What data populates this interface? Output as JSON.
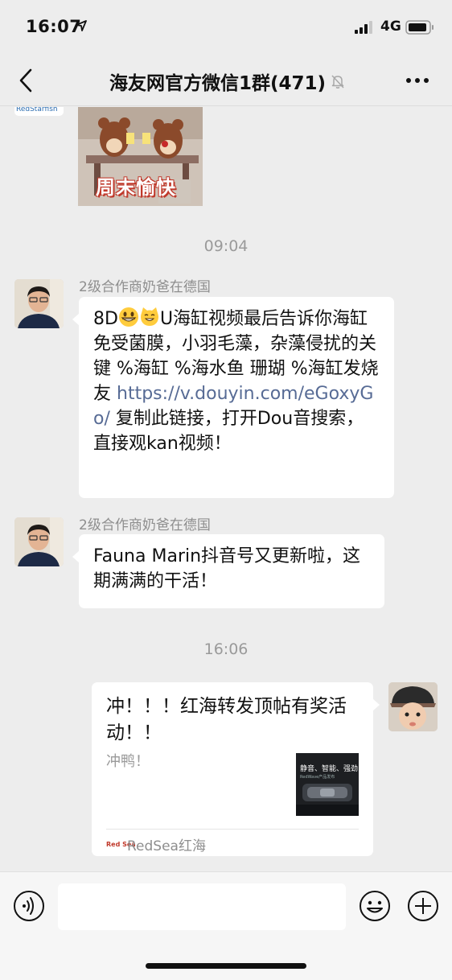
{
  "status_bar": {
    "time": "16:07",
    "network": "4G"
  },
  "nav": {
    "title": "海友网官方微信1群(471)"
  },
  "messages": [
    {
      "type": "sticker",
      "sticker_text": "周末愉快",
      "partial_avatar_text": "RedStarfish"
    },
    {
      "type": "timestamp",
      "text": "09:04"
    },
    {
      "type": "text",
      "sender": "2级合作商奶爸在德国",
      "text_part1": "8D",
      "text_part2": "U海缸视频最后告诉你海缸免受菌膜，小羽毛藻，杂藻侵扰的关键 %海缸 %海水鱼 珊瑚 %海缸发烧友 ",
      "link": "https://v.douyin.com/eGoxyGo/",
      "text_part3": " 复制此链接，打开Dou音搜索，直接观kan视频！"
    },
    {
      "type": "text",
      "sender": "2级合作商奶爸在德国",
      "text": "Fauna Marin抖音号又更新啦，这期满满的干活！"
    },
    {
      "type": "timestamp",
      "text": "16:06"
    },
    {
      "type": "link_card",
      "title": "冲！！！红海转发顶帖有奖活动！！",
      "description": "冲鸭！",
      "thumbnail_text": "静音、智能、强劲",
      "thumbnail_sub": "RedWave产品发布",
      "source_logo": "Red Sea",
      "source": "RedSea红海"
    }
  ],
  "colors": {
    "background": "#ededed",
    "bubble": "#ffffff",
    "link": "#576b95",
    "meta_text": "#9a9a9a"
  },
  "icons": [
    "location-arrow-icon",
    "signal-icon",
    "battery-icon",
    "back-icon",
    "mute-bell-icon",
    "more-icon",
    "voice-icon",
    "emoji-icon",
    "plus-icon"
  ]
}
